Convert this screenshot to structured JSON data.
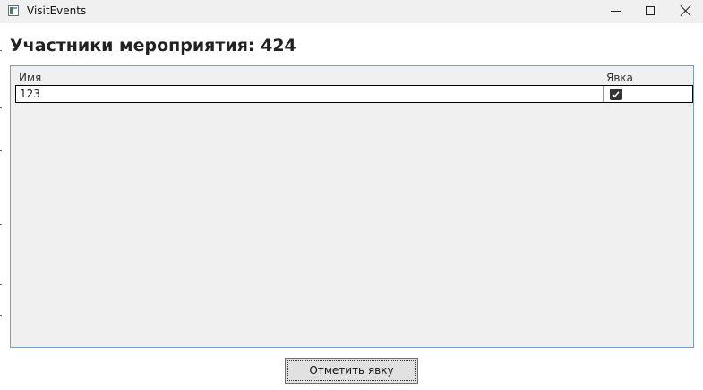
{
  "window": {
    "title": "VisitEvents",
    "icon": "app-window-icon",
    "controls": {
      "minimize_icon": "minimize-icon",
      "maximize_icon": "maximize-icon",
      "close_icon": "close-icon"
    }
  },
  "main": {
    "heading": "Участники мероприятия: 424",
    "grid": {
      "columns": [
        {
          "label": "Имя"
        },
        {
          "label": "Явка"
        }
      ],
      "rows": [
        {
          "name": "123",
          "attended": true
        }
      ]
    },
    "mark_button_label": "Отметить явку"
  },
  "colors": {
    "titlebar_bg": "#f0f0f0",
    "grid_border": "#7f9db9",
    "grid_bg": "#f0f0f0",
    "checkbox_fill": "#333333",
    "button_bg": "#e1e1e1"
  }
}
